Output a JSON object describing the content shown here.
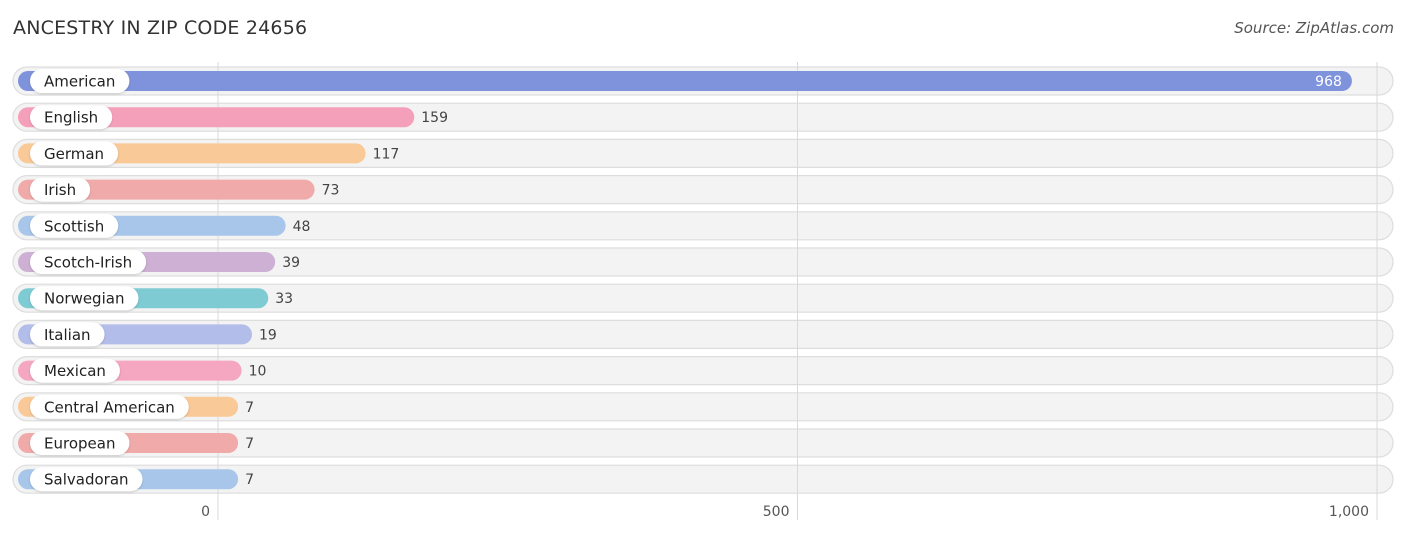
{
  "header": {
    "title": "ANCESTRY IN ZIP CODE 24656",
    "source": "Source: ZipAtlas.com"
  },
  "chart_data": {
    "type": "bar",
    "orientation": "horizontal",
    "title": "ANCESTRY IN ZIP CODE 24656",
    "xlabel": "",
    "ylabel": "",
    "xlim": [
      0,
      1000
    ],
    "xticks": [
      0,
      500,
      1000
    ],
    "xtick_labels": [
      "0",
      "500",
      "1,000"
    ],
    "grid": true,
    "categories": [
      "American",
      "English",
      "German",
      "Irish",
      "Scottish",
      "Scotch-Irish",
      "Norwegian",
      "Italian",
      "Mexican",
      "Central American",
      "European",
      "Salvadoran"
    ],
    "values": [
      968,
      159,
      117,
      73,
      48,
      39,
      33,
      19,
      10,
      7,
      7,
      7
    ],
    "value_labels": [
      "968",
      "159",
      "117",
      "73",
      "48",
      "39",
      "33",
      "19",
      "10",
      "7",
      "7",
      "7"
    ],
    "colors": [
      "#7f92dc",
      "#f5a0bb",
      "#f9c998",
      "#f0aaaa",
      "#a7c6ea",
      "#cdb0d3",
      "#7ecbd3",
      "#b3bde9",
      "#f5a6c0",
      "#f9c998",
      "#f0aaaa",
      "#a7c6ea"
    ]
  }
}
